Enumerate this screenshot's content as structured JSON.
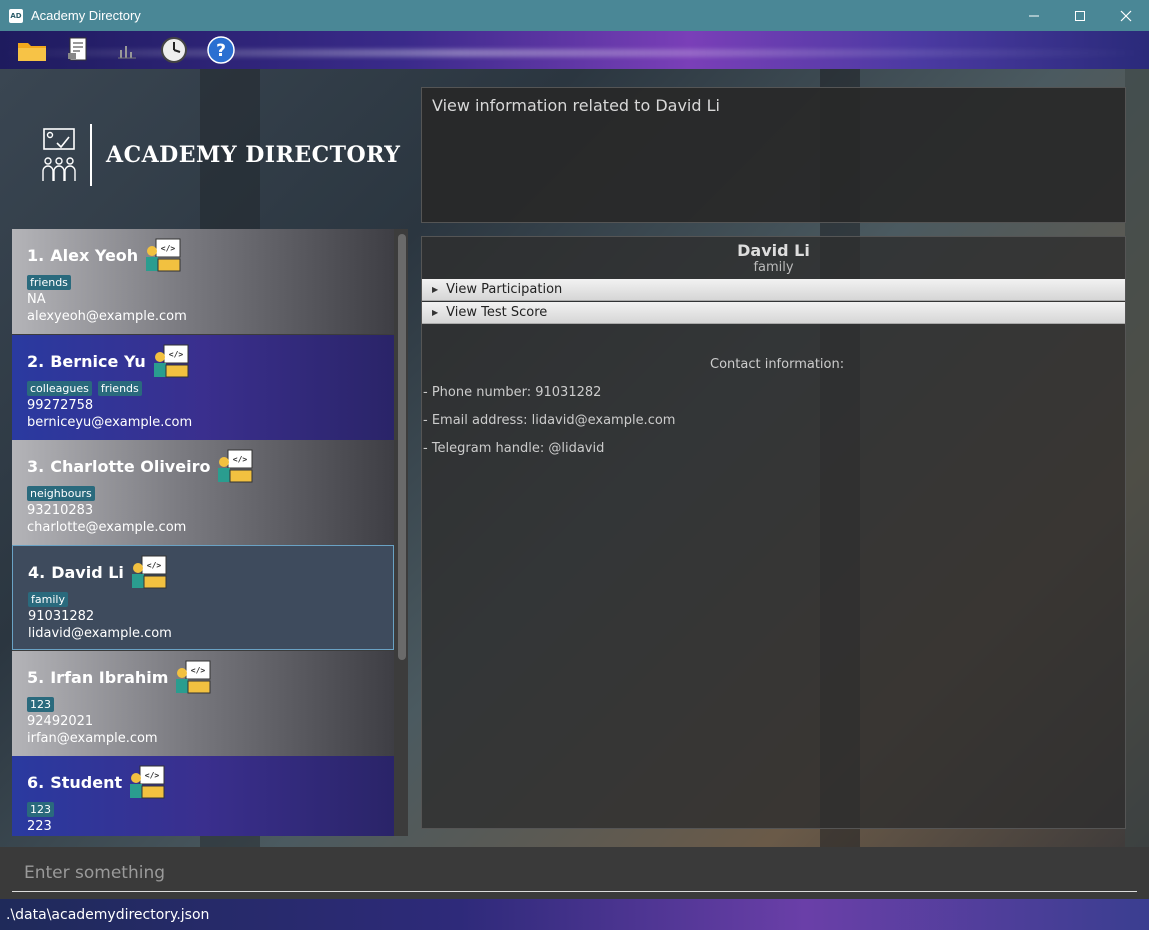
{
  "window": {
    "title": "Academy Directory",
    "app_icon_text": "AD"
  },
  "menu": [
    {
      "name": "folder-icon"
    },
    {
      "name": "document-icon"
    },
    {
      "name": "bar-chart-icon"
    },
    {
      "name": "clock-icon"
    },
    {
      "name": "help-icon"
    }
  ],
  "header": {
    "logo_title": "ACADEMY DIRECTORY"
  },
  "result": {
    "text": "View information related to David Li"
  },
  "students": [
    {
      "index": "1.",
      "name": "Alex Yeoh",
      "tags": [
        "friends"
      ],
      "phone": "NA",
      "email": "alexyeoh@example.com"
    },
    {
      "index": "2.",
      "name": "Bernice Yu",
      "tags": [
        "colleagues",
        "friends"
      ],
      "phone": "99272758",
      "email": "berniceyu@example.com"
    },
    {
      "index": "3.",
      "name": "Charlotte Oliveiro",
      "tags": [
        "neighbours"
      ],
      "phone": "93210283",
      "email": "charlotte@example.com"
    },
    {
      "index": "4.",
      "name": "David Li",
      "tags": [
        "family"
      ],
      "phone": "91031282",
      "email": "lidavid@example.com"
    },
    {
      "index": "5.",
      "name": "Irfan Ibrahim",
      "tags": [
        "123"
      ],
      "phone": "92492021",
      "email": "irfan@example.com"
    },
    {
      "index": "6.",
      "name": "Student",
      "tags": [
        "123"
      ],
      "phone": "223",
      "email": ""
    }
  ],
  "detail": {
    "name": "David Li",
    "tag": "family",
    "accordions": [
      "View Participation",
      "View Test Score"
    ],
    "contact_title": "Contact information:",
    "phone": "- Phone number: 91031282",
    "email": "- Email address: lidavid@example.com",
    "telegram": "- Telegram handle: @lidavid"
  },
  "command": {
    "placeholder": "Enter something"
  },
  "status": {
    "path": ".\\data\\academydirectory.json"
  },
  "colors": {
    "titlebar": "#4a8796",
    "tag": "#2a6a7d",
    "selected_border": "#6aa2c4"
  }
}
